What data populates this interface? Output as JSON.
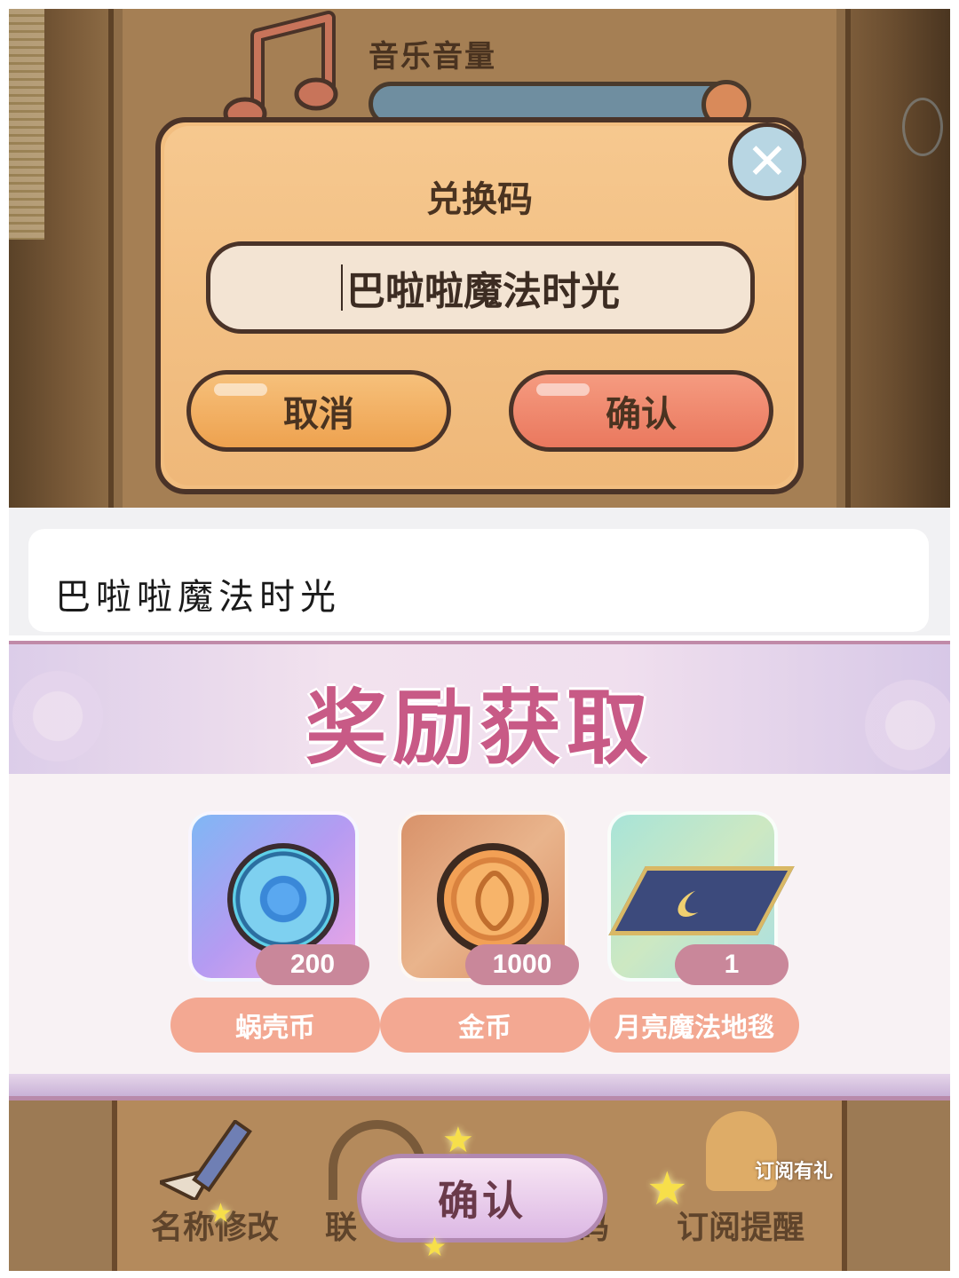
{
  "settings": {
    "music_volume_label": "音乐音量",
    "music_icon": "music-note-icon",
    "slider_level": 0.9
  },
  "redeem_dialog": {
    "title": "兑换码",
    "input_value": "巴啦啦魔法时光",
    "cancel_label": "取消",
    "confirm_label": "确认",
    "close_icon": "close-icon"
  },
  "text_input": {
    "value": "巴啦啦魔法时光"
  },
  "reward_popup": {
    "title": "奖励获取",
    "items": [
      {
        "name": "蜗壳币",
        "quantity": "200",
        "icon": "snail-shell-coin-icon"
      },
      {
        "name": "金币",
        "quantity": "1000",
        "icon": "gold-coin-icon"
      },
      {
        "name": "月亮魔法地毯",
        "quantity": "1",
        "icon": "moon-magic-carpet-icon"
      }
    ],
    "confirm_label": "确认"
  },
  "background_menu": {
    "items": [
      "名称修改",
      "联",
      "码",
      "订阅提醒"
    ],
    "gift_label": "订阅有礼"
  },
  "colors": {
    "dialog_fill": "#f2be80",
    "cancel_button": "#eea24f",
    "confirm_button": "#ea785e",
    "reward_title": "#c85a86",
    "quantity_pill": "#c9879a",
    "name_pill": "#f3a892"
  }
}
